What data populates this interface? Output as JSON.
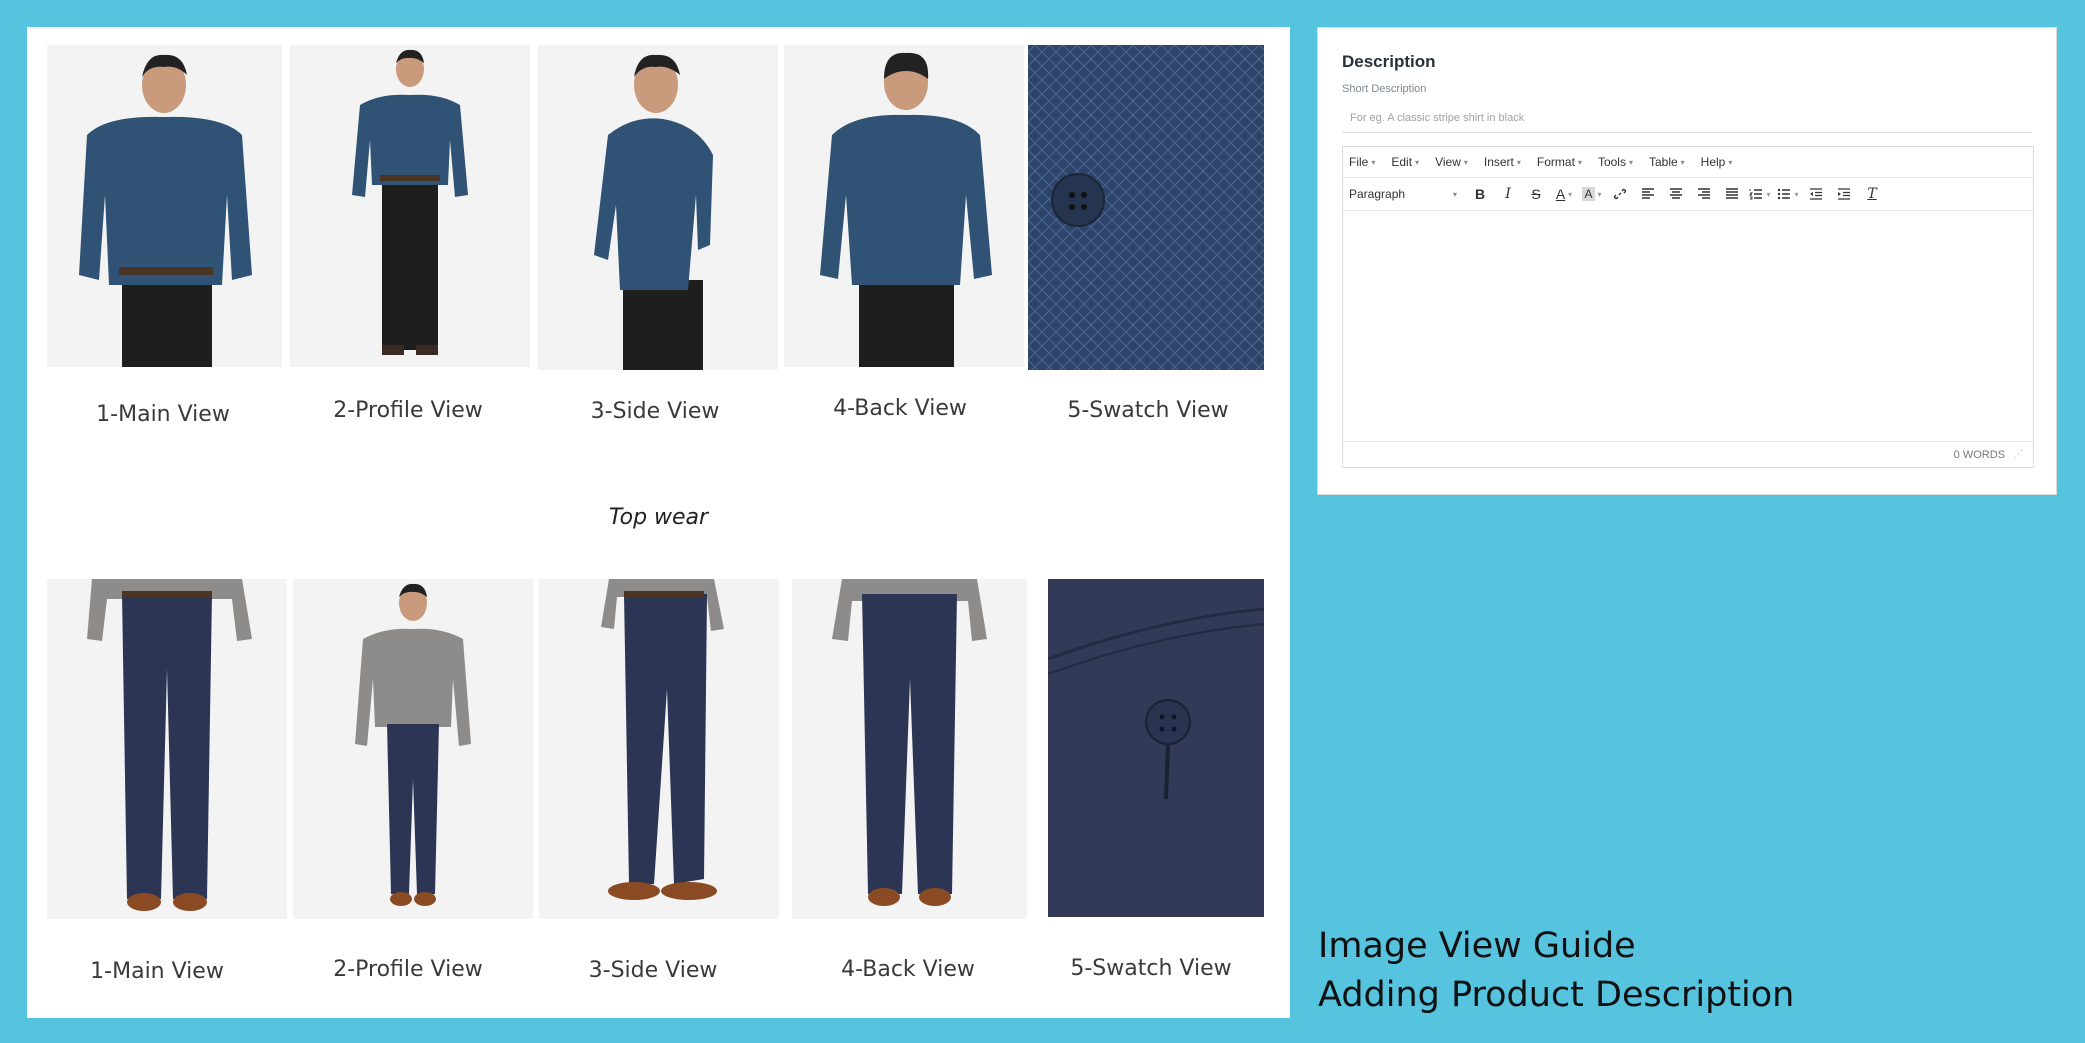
{
  "guide": {
    "top_row_labels": [
      "1-Main View",
      "2-Profile View",
      "3-Side View",
      "4-Back View",
      "5-Swatch View"
    ],
    "section_caption": "Top wear",
    "bottom_row_labels": [
      "1-Main View",
      "2-Profile View",
      "3-Side View",
      "4-Back View",
      "5-Swatch View"
    ]
  },
  "description_card": {
    "title": "Description",
    "short_description_label": "Short Description",
    "short_description_placeholder": "For eg. A classic stripe shirt in black",
    "menu": [
      "File",
      "Edit",
      "View",
      "Insert",
      "Format",
      "Tools",
      "Table",
      "Help"
    ],
    "format_select": "Paragraph",
    "word_count": "0 WORDS"
  },
  "footer": {
    "line1": "Image View Guide",
    "line2": "Adding Product Description"
  },
  "colors": {
    "background": "#56c3df",
    "shirt_blue": "#2f5275",
    "pants_navy": "#2c3553",
    "shirt_grey": "#8d8c8a"
  }
}
